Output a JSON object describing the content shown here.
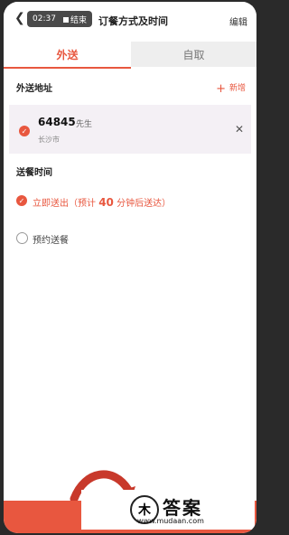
{
  "status_bar": {
    "time": "02:37",
    "end_label": "结束"
  },
  "header": {
    "title": "订餐方式及时间",
    "edit_label": "编辑"
  },
  "tabs": [
    {
      "label": "外送"
    },
    {
      "label": "自取"
    }
  ],
  "address_section": {
    "label": "外送地址",
    "add_label": "新增"
  },
  "address": {
    "phone": "64845",
    "salutation": "先生",
    "city": "长沙市"
  },
  "delivery_section": {
    "label": "送餐时间"
  },
  "options": {
    "immediate": {
      "prefix": "立即送出（预计",
      "minutes": "40",
      "suffix": "分钟后送达）"
    },
    "scheduled": {
      "label": "预约送餐"
    }
  },
  "watermark": {
    "text": "答案",
    "url": "www.mudaan.com"
  },
  "colors": {
    "accent": "#e8573f"
  }
}
